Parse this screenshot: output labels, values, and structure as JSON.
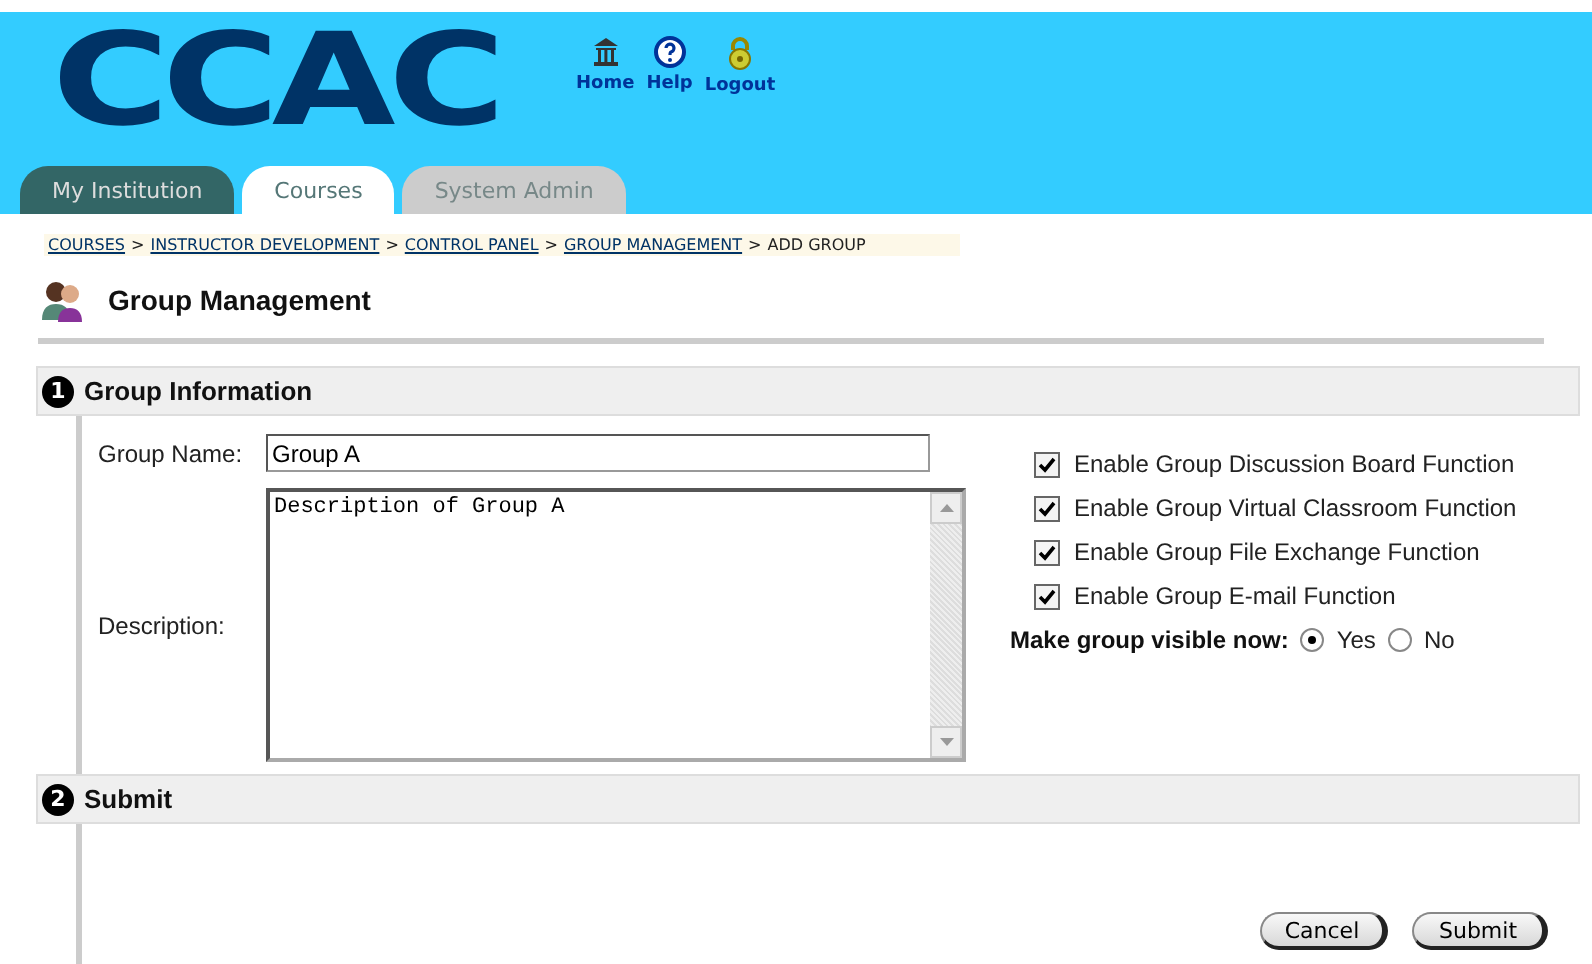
{
  "header": {
    "logo": "CCAC",
    "links": [
      {
        "kind": "home",
        "label": "Home"
      },
      {
        "kind": "help",
        "label": "Help"
      },
      {
        "kind": "logout",
        "label": "Logout"
      }
    ]
  },
  "tabs": [
    {
      "label": "My Institution",
      "selected": false,
      "kind": "dark"
    },
    {
      "label": "Courses",
      "selected": true,
      "kind": "light"
    },
    {
      "label": "System Admin",
      "selected": false,
      "kind": "grey"
    }
  ],
  "breadcrumb": {
    "links": [
      "COURSES",
      "INSTRUCTOR DEVELOPMENT",
      "CONTROL PANEL",
      "GROUP MANAGEMENT"
    ],
    "current": "ADD GROUP",
    "separator": ">"
  },
  "page_title": "Group Management",
  "sections": [
    {
      "number": "1",
      "title": "Group Information"
    },
    {
      "number": "2",
      "title": "Submit"
    }
  ],
  "form": {
    "name_label": "Group Name:",
    "name_value": "Group A",
    "description_label": "Description:",
    "description_value": "Description of Group A",
    "options": [
      {
        "label": "Enable Group Discussion Board Function",
        "checked": true
      },
      {
        "label": "Enable Group Virtual Classroom Function",
        "checked": true
      },
      {
        "label": "Enable Group File Exchange Function",
        "checked": true
      },
      {
        "label": "Enable Group E-mail Function",
        "checked": true
      }
    ],
    "visible_label": "Make group visible now:",
    "visible_choices": [
      {
        "label": "Yes",
        "selected": true
      },
      {
        "label": "No",
        "selected": false
      }
    ]
  },
  "buttons": [
    "Cancel",
    "Submit"
  ]
}
